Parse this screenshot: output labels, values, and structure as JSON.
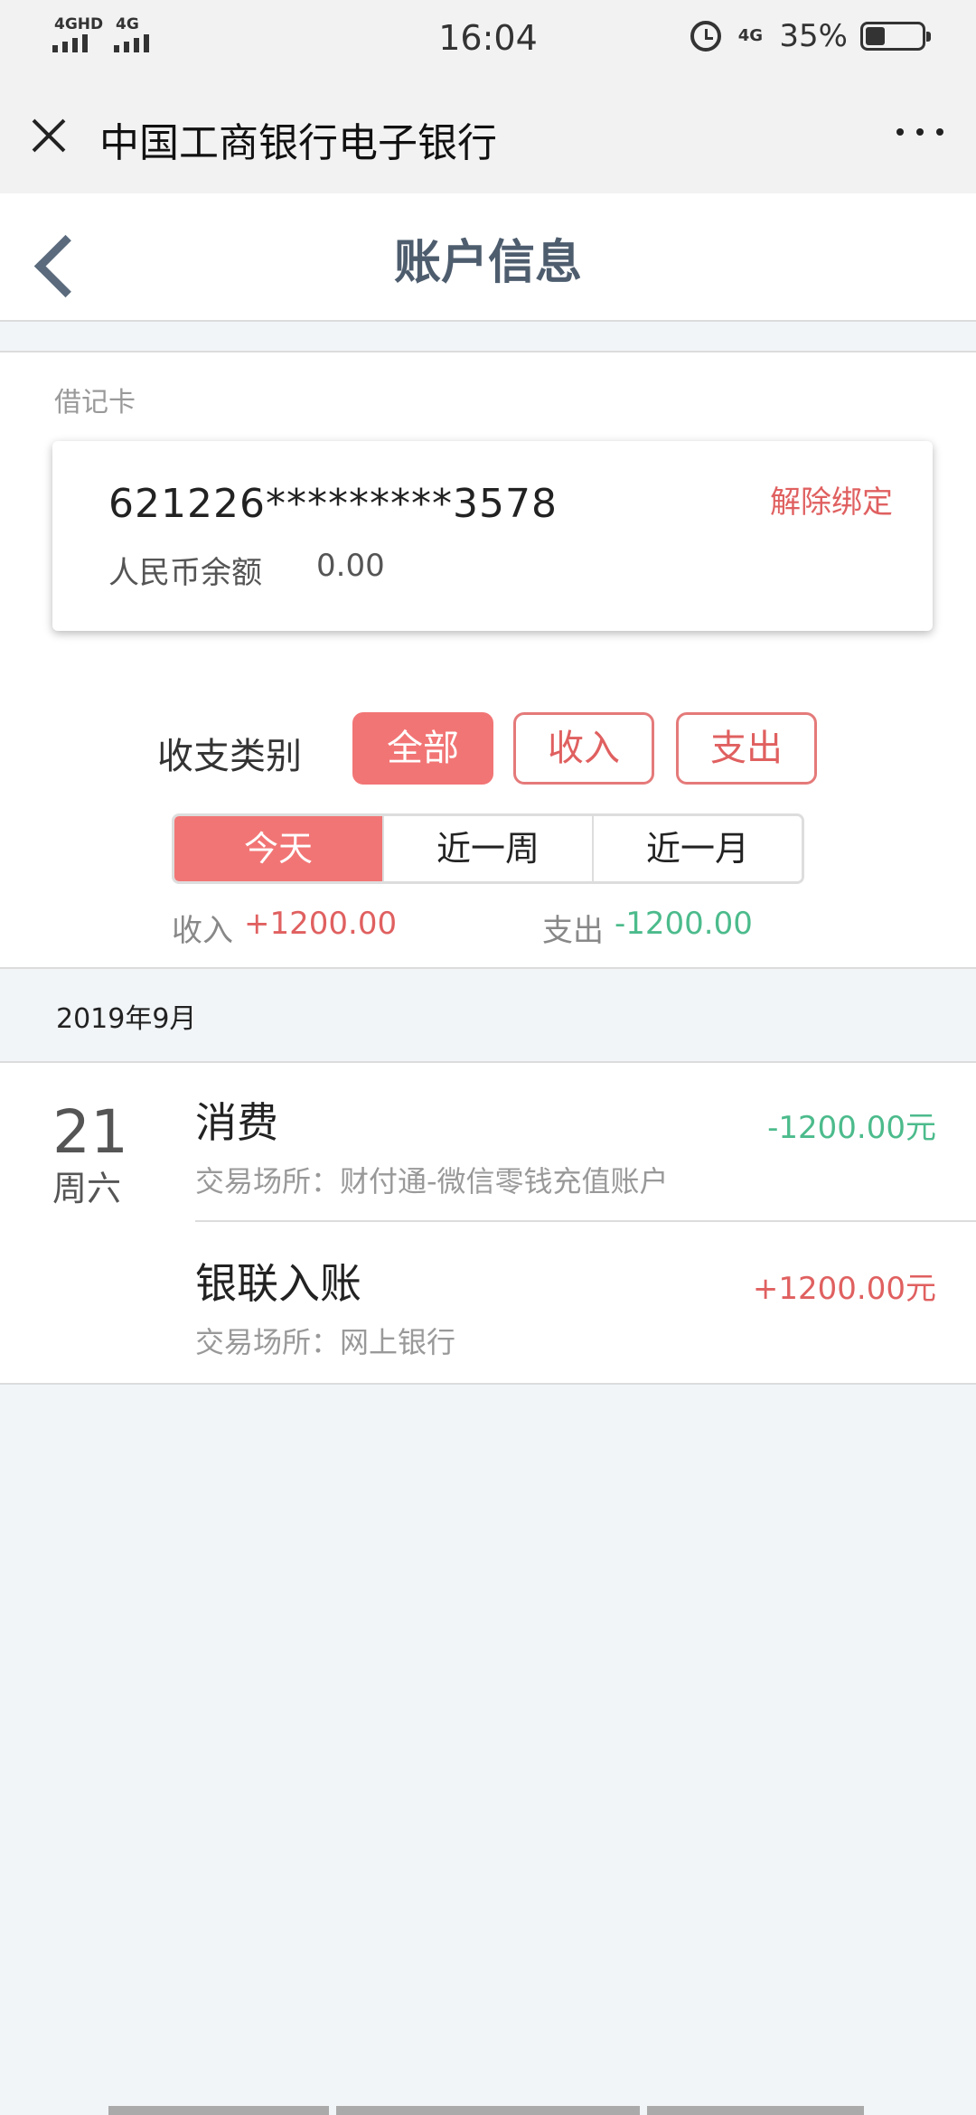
{
  "status_bar": {
    "sim1_label": "4GHD",
    "sim2_label": "4G",
    "time": "16:04",
    "net_label": "4G",
    "battery_percent": "35%",
    "battery_level": 0.35
  },
  "titlebar": {
    "title": "中国工商银行电子银行"
  },
  "header": {
    "title": "账户信息"
  },
  "account": {
    "card_type": "借记卡",
    "card_number": "621226*********3578",
    "balance_label": "人民币余额",
    "balance_value": "0.00",
    "unbind_label": "解除绑定"
  },
  "filter": {
    "label": "收支类别",
    "types": [
      "全部",
      "收入",
      "支出"
    ],
    "active_type": "全部",
    "periods": [
      "今天",
      "近一周",
      "近一月"
    ],
    "active_period": "今天"
  },
  "summary": {
    "income_label": "收入",
    "income_value": "+1200.00",
    "expense_label": "支出",
    "expense_value": "-1200.00"
  },
  "month_header": "2019年9月",
  "transactions": {
    "day": "21",
    "weekday": "周六",
    "items": [
      {
        "name": "消费",
        "place": "交易场所：财付通-微信零钱充值账户",
        "amount": "-1200.00元"
      },
      {
        "name": "银联入账",
        "place": "交易场所：网上银行",
        "amount": "+1200.00元"
      }
    ]
  },
  "colors": {
    "accent": "#f27575",
    "income": "#e06060",
    "expense": "#4cbb8c",
    "header_text": "#4e5d6e"
  }
}
